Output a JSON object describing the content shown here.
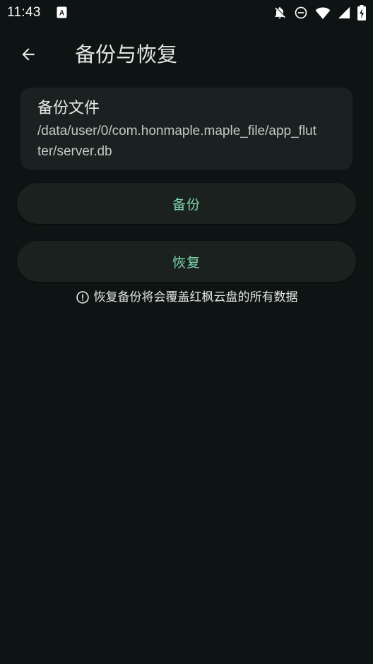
{
  "status_bar": {
    "time": "11:43",
    "app_icon_letter": "A",
    "icons": [
      "notifications-off-icon",
      "do-not-disturb-icon",
      "wifi-icon",
      "signal-icon",
      "battery-charging-icon"
    ]
  },
  "app_bar": {
    "back_icon": "arrow-back-icon",
    "title": "备份与恢复"
  },
  "backup_file": {
    "title": "备份文件",
    "path": "/data/user/0/com.honmaple.maple_file/app_flutter/server.db"
  },
  "actions": {
    "backup_label": "备份",
    "restore_label": "恢复"
  },
  "warning": {
    "icon": "info-icon",
    "text": "恢复备份将会覆盖红枫云盘的所有数据"
  },
  "colors": {
    "background": "#0e1413",
    "card": "#1b2120",
    "button": "#1a211f",
    "accent": "#7fd5ad",
    "text": "#e2e6e4"
  }
}
